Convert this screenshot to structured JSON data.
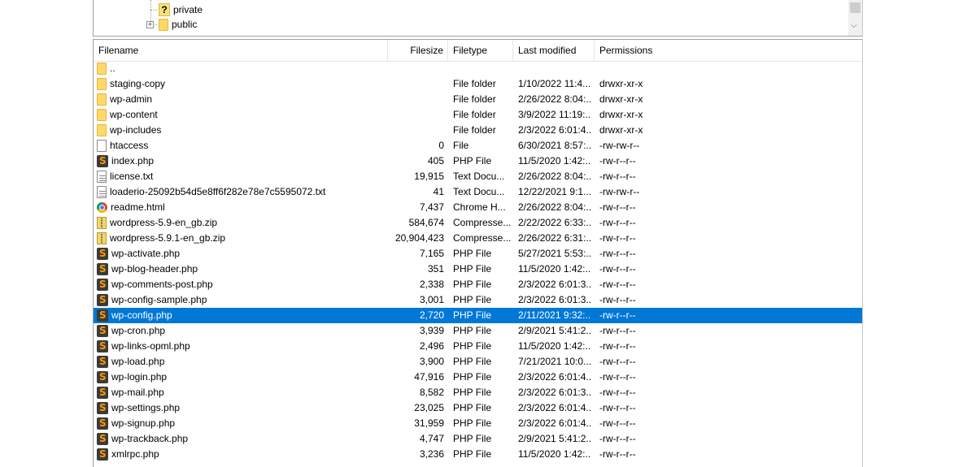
{
  "tree": {
    "items": [
      {
        "label": "private",
        "icon": "unknown-folder-icon"
      },
      {
        "label": "public",
        "icon": "folder-icon",
        "expander": "+"
      }
    ]
  },
  "list": {
    "columns": {
      "filename": "Filename",
      "filesize": "Filesize",
      "filetype": "Filetype",
      "last_modified": "Last modified",
      "permissions": "Permissions"
    },
    "rows": [
      {
        "name": "..",
        "size": "",
        "type": "",
        "modified": "",
        "perms": "",
        "icon": "folder-icon"
      },
      {
        "name": "staging-copy",
        "size": "",
        "type": "File folder",
        "modified": "1/10/2022 11:4...",
        "perms": "drwxr-xr-x",
        "icon": "folder-icon"
      },
      {
        "name": "wp-admin",
        "size": "",
        "type": "File folder",
        "modified": "2/26/2022 8:04:...",
        "perms": "drwxr-xr-x",
        "icon": "folder-icon"
      },
      {
        "name": "wp-content",
        "size": "",
        "type": "File folder",
        "modified": "3/9/2022 11:19:...",
        "perms": "drwxr-xr-x",
        "icon": "folder-icon"
      },
      {
        "name": "wp-includes",
        "size": "",
        "type": "File folder",
        "modified": "2/3/2022 6:01:4...",
        "perms": "drwxr-xr-x",
        "icon": "folder-icon"
      },
      {
        "name": "htaccess",
        "size": "0",
        "type": "File",
        "modified": "6/30/2021 8:57:...",
        "perms": "-rw-rw-r--",
        "icon": "file-icon"
      },
      {
        "name": "index.php",
        "size": "405",
        "type": "PHP File",
        "modified": "11/5/2020 1:42:...",
        "perms": "-rw-r--r--",
        "icon": "php-icon"
      },
      {
        "name": "license.txt",
        "size": "19,915",
        "type": "Text Docu...",
        "modified": "2/26/2022 8:04:...",
        "perms": "-rw-r--r--",
        "icon": "txt-icon"
      },
      {
        "name": "loaderio-25092b54d5e8ff6f282e78e7c5595072.txt",
        "size": "41",
        "type": "Text Docu...",
        "modified": "12/22/2021 9:1...",
        "perms": "-rw-rw-r--",
        "icon": "txt-icon"
      },
      {
        "name": "readme.html",
        "size": "7,437",
        "type": "Chrome H...",
        "modified": "2/26/2022 8:04:...",
        "perms": "-rw-r--r--",
        "icon": "chrome-icon"
      },
      {
        "name": "wordpress-5.9-en_gb.zip",
        "size": "584,674",
        "type": "Compresse...",
        "modified": "2/22/2022 6:33:...",
        "perms": "-rw-r--r--",
        "icon": "zip-icon"
      },
      {
        "name": "wordpress-5.9.1-en_gb.zip",
        "size": "20,904,423",
        "type": "Compresse...",
        "modified": "2/26/2022 6:31:...",
        "perms": "-rw-r--r--",
        "icon": "zip-icon"
      },
      {
        "name": "wp-activate.php",
        "size": "7,165",
        "type": "PHP File",
        "modified": "5/27/2021 5:53:...",
        "perms": "-rw-r--r--",
        "icon": "php-icon"
      },
      {
        "name": "wp-blog-header.php",
        "size": "351",
        "type": "PHP File",
        "modified": "11/5/2020 1:42:...",
        "perms": "-rw-r--r--",
        "icon": "php-icon"
      },
      {
        "name": "wp-comments-post.php",
        "size": "2,338",
        "type": "PHP File",
        "modified": "2/3/2022 6:01:3...",
        "perms": "-rw-r--r--",
        "icon": "php-icon"
      },
      {
        "name": "wp-config-sample.php",
        "size": "3,001",
        "type": "PHP File",
        "modified": "2/3/2022 6:01:3...",
        "perms": "-rw-r--r--",
        "icon": "php-icon"
      },
      {
        "name": "wp-config.php",
        "size": "2,720",
        "type": "PHP File",
        "modified": "2/11/2021 9:32:...",
        "perms": "-rw-r--r--",
        "icon": "php-icon",
        "selected": true
      },
      {
        "name": "wp-cron.php",
        "size": "3,939",
        "type": "PHP File",
        "modified": "2/9/2021 5:41:2...",
        "perms": "-rw-r--r--",
        "icon": "php-icon"
      },
      {
        "name": "wp-links-opml.php",
        "size": "2,496",
        "type": "PHP File",
        "modified": "11/5/2020 1:42:...",
        "perms": "-rw-r--r--",
        "icon": "php-icon"
      },
      {
        "name": "wp-load.php",
        "size": "3,900",
        "type": "PHP File",
        "modified": "7/21/2021 10:0...",
        "perms": "-rw-r--r--",
        "icon": "php-icon"
      },
      {
        "name": "wp-login.php",
        "size": "47,916",
        "type": "PHP File",
        "modified": "2/3/2022 6:01:4...",
        "perms": "-rw-r--r--",
        "icon": "php-icon"
      },
      {
        "name": "wp-mail.php",
        "size": "8,582",
        "type": "PHP File",
        "modified": "2/3/2022 6:01:3...",
        "perms": "-rw-r--r--",
        "icon": "php-icon"
      },
      {
        "name": "wp-settings.php",
        "size": "23,025",
        "type": "PHP File",
        "modified": "2/3/2022 6:01:4...",
        "perms": "-rw-r--r--",
        "icon": "php-icon"
      },
      {
        "name": "wp-signup.php",
        "size": "31,959",
        "type": "PHP File",
        "modified": "2/3/2022 6:01:4...",
        "perms": "-rw-r--r--",
        "icon": "php-icon"
      },
      {
        "name": "wp-trackback.php",
        "size": "4,747",
        "type": "PHP File",
        "modified": "2/9/2021 5:41:2...",
        "perms": "-rw-r--r--",
        "icon": "php-icon"
      },
      {
        "name": "xmlrpc.php",
        "size": "3,236",
        "type": "PHP File",
        "modified": "11/5/2020 1:42:...",
        "perms": "-rw-r--r--",
        "icon": "php-icon"
      }
    ]
  },
  "colors": {
    "selection": "#0078d7",
    "folder": "#ffd866",
    "php_icon_bg": "#3a3a3a",
    "php_icon_fg": "#ff9800"
  }
}
